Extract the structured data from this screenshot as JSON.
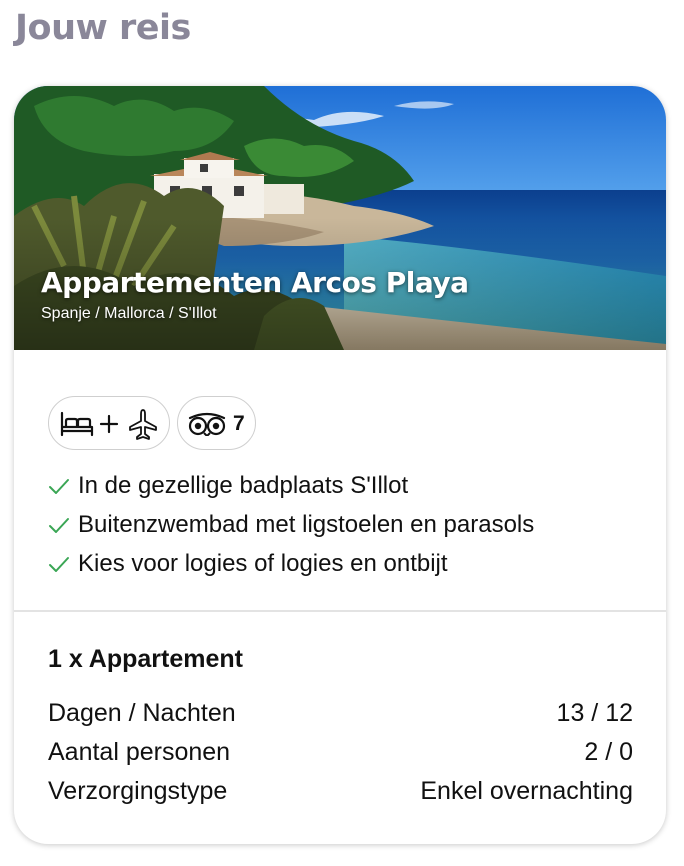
{
  "section": {
    "title": "Jouw reis"
  },
  "hotel": {
    "name": "Appartementen Arcos Playa",
    "location": "Spanje / Mallorca / S'Illot"
  },
  "badges": {
    "travel": {
      "icons": [
        "bed-icon",
        "plus-icon",
        "airplane-icon"
      ]
    },
    "rating": {
      "icon": "tripadvisor-owl-icon",
      "value": "7"
    }
  },
  "features": [
    {
      "icon": "check-icon",
      "text": "In de gezellige badplaats S'Illot"
    },
    {
      "icon": "check-icon",
      "text": "Buitenzwembad met ligstoelen en parasols"
    },
    {
      "icon": "check-icon",
      "text": "Kies voor logies of logies en ontbijt"
    }
  ],
  "room": {
    "title": "1 x Appartement",
    "details": [
      {
        "label": "Dagen / Nachten",
        "value": "13 / 12"
      },
      {
        "label": "Aantal personen",
        "value": "2 / 0"
      },
      {
        "label": "Verzorgingstype",
        "value": "Enkel overnachting"
      }
    ]
  },
  "colors": {
    "heading": "#8a8799",
    "check": "#3aa655",
    "pill_border": "#cfcfcf"
  }
}
